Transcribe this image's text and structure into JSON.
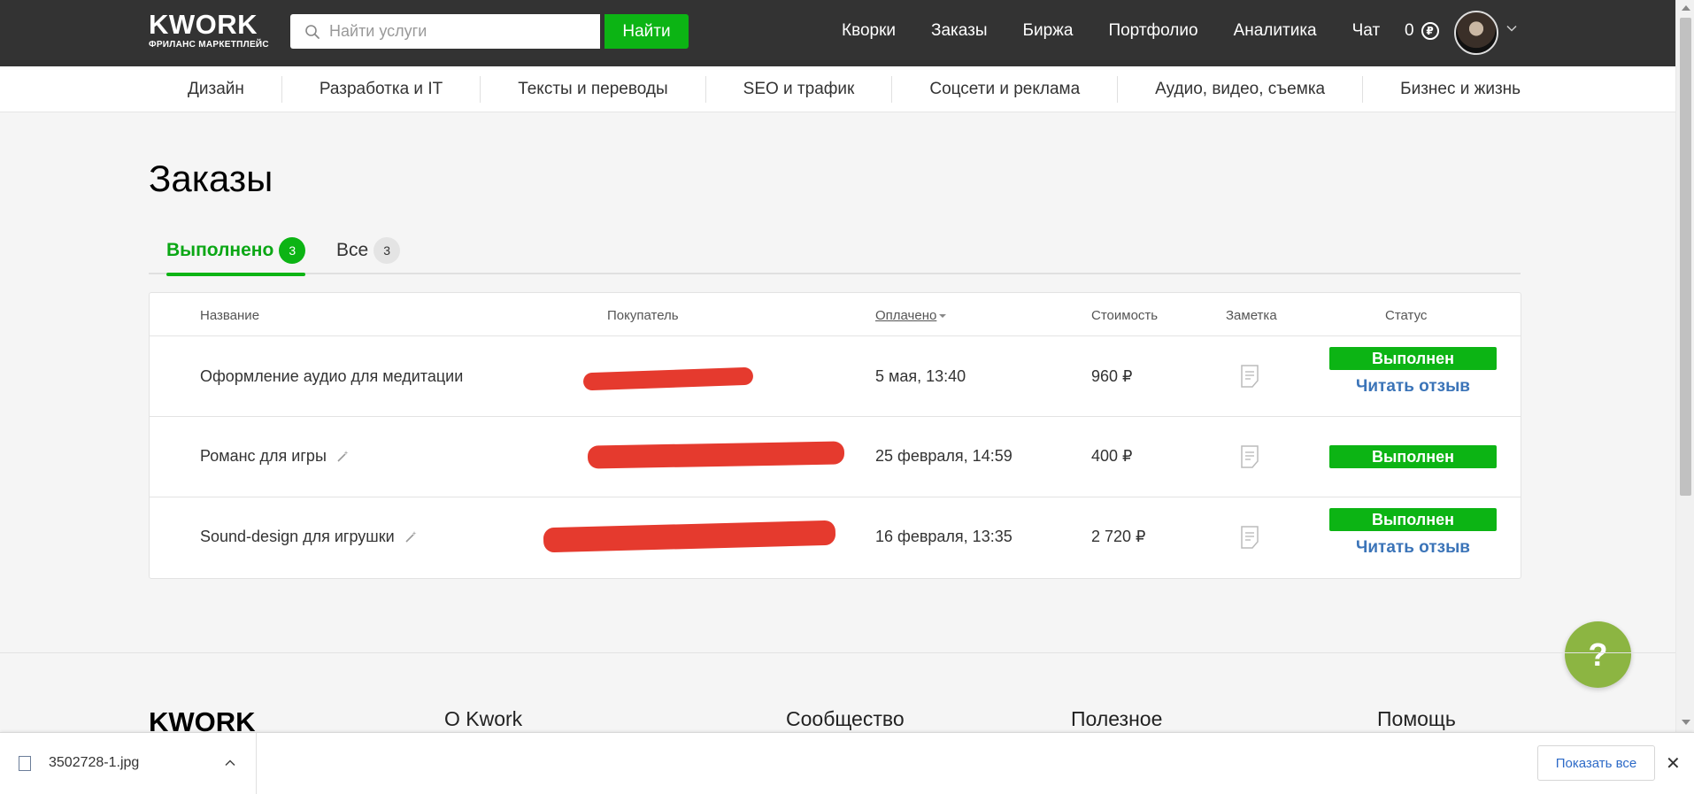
{
  "header": {
    "logo_text": "KWORK",
    "logo_tagline": "ФРИЛАНС МАРКЕТПЛЕЙС",
    "search_placeholder": "Найти услуги",
    "search_button": "Найти",
    "nav": [
      "Кворки",
      "Заказы",
      "Биржа",
      "Портфолио",
      "Аналитика",
      "Чат"
    ],
    "balance": "0",
    "currency_icon": "₽"
  },
  "categories": [
    "Дизайн",
    "Разработка и IT",
    "Тексты и переводы",
    "SEO и трафик",
    "Соцсети и реклама",
    "Аудио, видео, съемка",
    "Бизнес и жизнь"
  ],
  "page": {
    "title": "Заказы",
    "tabs": [
      {
        "label": "Выполнено",
        "count": "3"
      },
      {
        "label": "Все",
        "count": "3"
      }
    ]
  },
  "table": {
    "columns": {
      "name": "Название",
      "buyer": "Покупатель",
      "paid": "Оплачено",
      "cost": "Стоимость",
      "note": "Заметка",
      "status": "Статус"
    },
    "rows": [
      {
        "name": "Оформление аудио для медитации",
        "date": "5 мая, 13:40",
        "cost": "960 ₽",
        "status": "Выполнен",
        "review": "Читать отзыв"
      },
      {
        "name": "Романс для игры",
        "date": "25 февраля, 14:59",
        "cost": "400 ₽",
        "status": "Выполнен",
        "review": ""
      },
      {
        "name": "Sound-design для игрушки",
        "date": "16 февраля, 13:35",
        "cost": "2 720 ₽",
        "status": "Выполнен",
        "review": "Читать отзыв"
      }
    ]
  },
  "help_button": "?",
  "footer": {
    "logo_text": "KWORK",
    "columns": [
      "О Kwork",
      "Сообщество",
      "Полезное",
      "Помощь"
    ]
  },
  "download_bar": {
    "file_name": "3502728-1.jpg",
    "show_all": "Показать все",
    "close": "✕"
  },
  "colors": {
    "header_bg": "#333333",
    "accent_green": "#0cb414",
    "link_blue": "#3b74b8",
    "redaction_red": "#e53a2e",
    "help_green": "#8cb542"
  }
}
